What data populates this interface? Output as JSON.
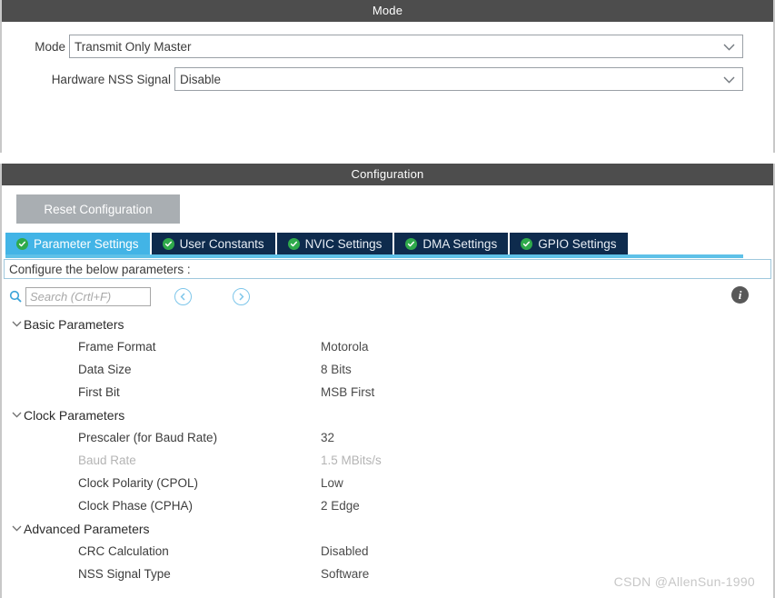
{
  "mode_panel": {
    "title": "Mode",
    "fields": [
      {
        "label": "Mode",
        "value": "Transmit Only Master",
        "icon": "chevron-down-icon"
      },
      {
        "label": "Hardware NSS Signal",
        "value": "Disable",
        "icon": "chevron-down-icon"
      }
    ]
  },
  "config_panel": {
    "title": "Configuration",
    "reset_button": "Reset Configuration",
    "tabs": [
      {
        "label": "Parameter Settings",
        "active": true,
        "icon": "check-circle-icon"
      },
      {
        "label": "User Constants",
        "active": false,
        "icon": "check-circle-icon"
      },
      {
        "label": "NVIC Settings",
        "active": false,
        "icon": "check-circle-icon"
      },
      {
        "label": "DMA Settings",
        "active": false,
        "icon": "check-circle-icon"
      },
      {
        "label": "GPIO Settings",
        "active": false,
        "icon": "check-circle-icon"
      }
    ],
    "configure_hint": "Configure the below parameters :",
    "search": {
      "placeholder": "Search (Crtl+F)",
      "value": "",
      "icon": "search-icon",
      "prev_icon": "‹",
      "next_icon": "›"
    },
    "info_icon_label": "i",
    "tree": [
      {
        "group": "Basic Parameters",
        "expanded": true,
        "rows": [
          {
            "name": "Frame Format",
            "value": "Motorola",
            "disabled": false
          },
          {
            "name": "Data Size",
            "value": "8 Bits",
            "disabled": false
          },
          {
            "name": "First Bit",
            "value": "MSB First",
            "disabled": false
          }
        ]
      },
      {
        "group": "Clock Parameters",
        "expanded": true,
        "rows": [
          {
            "name": "Prescaler (for Baud Rate)",
            "value": "32",
            "disabled": false
          },
          {
            "name": "Baud Rate",
            "value": "1.5 MBits/s",
            "disabled": true
          },
          {
            "name": "Clock Polarity (CPOL)",
            "value": "Low",
            "disabled": false
          },
          {
            "name": "Clock Phase (CPHA)",
            "value": "2 Edge",
            "disabled": false
          }
        ]
      },
      {
        "group": "Advanced Parameters",
        "expanded": true,
        "rows": [
          {
            "name": "CRC Calculation",
            "value": "Disabled",
            "disabled": false
          },
          {
            "name": "NSS Signal Type",
            "value": "Software",
            "disabled": false
          }
        ]
      }
    ]
  },
  "watermark": "CSDN @AllenSun-1990",
  "colors": {
    "panel_header_bg": "#4d4d4d",
    "tab_active_bg": "#42b4e6",
    "tab_inactive_bg": "#0e2b4d",
    "check_green": "#2faa4b",
    "accent_blue": "#5ec1e8",
    "reset_button_bg": "#a9aeb2"
  }
}
